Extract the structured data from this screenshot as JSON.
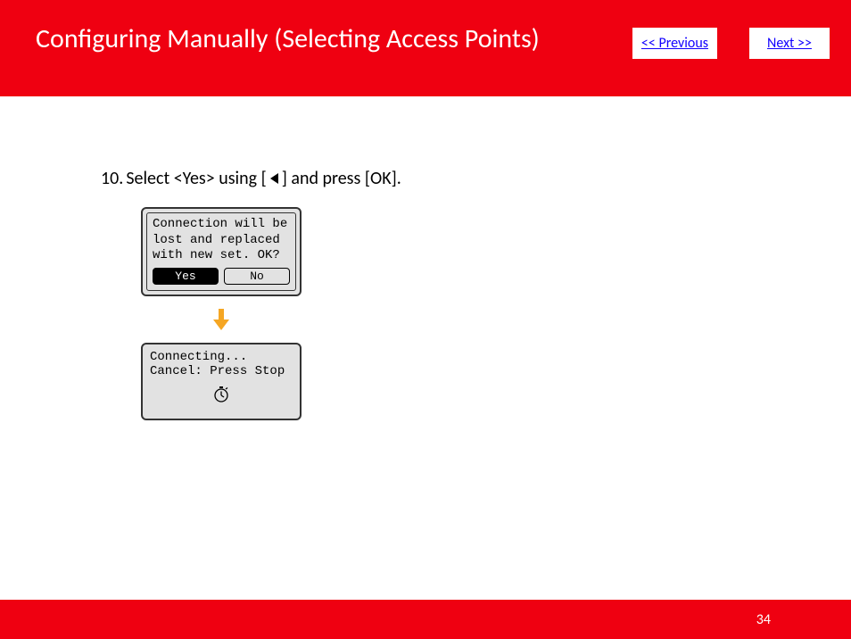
{
  "header": {
    "title": "Configuring Manually (Selecting Access Points)",
    "prev": "<< Previous",
    "next": "Next >>"
  },
  "step": {
    "num": "10.",
    "t1": "Select <Yes> using [",
    "t2": "] and press [OK]."
  },
  "screen1": {
    "l1": "Connection will be",
    "l2": "lost and replaced",
    "l3": "with new set. OK?",
    "yes": "Yes",
    "no": "No"
  },
  "screen2": {
    "l1": "Connecting...",
    "l2": "Cancel: Press Stop"
  },
  "footer": {
    "page": "34"
  }
}
